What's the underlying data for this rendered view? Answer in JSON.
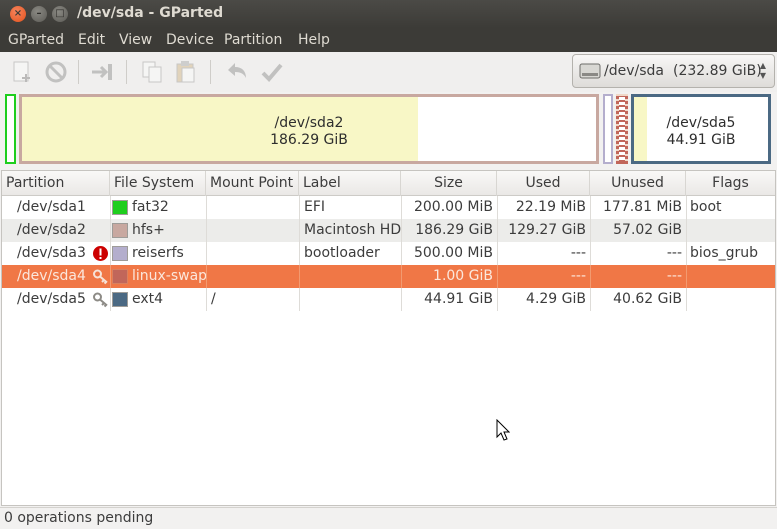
{
  "window": {
    "title": "/dev/sda - GParted"
  },
  "menu": [
    "GParted",
    "Edit",
    "View",
    "Device",
    "Partition",
    "Help"
  ],
  "toolbar": {
    "buttons": [
      "new-icon",
      "delete-icon",
      "resize-move-icon",
      "copy-icon",
      "paste-icon",
      "undo-icon",
      "apply-icon"
    ]
  },
  "device": {
    "name": "/dev/sda",
    "size": "(232.89 GiB)"
  },
  "partition_map": {
    "sda2": {
      "name": "/dev/sda2",
      "size": "186.29 GiB",
      "used_fraction": 0.69
    },
    "sda5": {
      "name": "/dev/sda5",
      "size": "44.91 GiB",
      "used_fraction": 0.1
    }
  },
  "columns": [
    "Partition",
    "File System",
    "Mount Point",
    "Label",
    "Size",
    "Used",
    "Unused",
    "Flags"
  ],
  "rows": [
    {
      "partition": "/dev/sda1",
      "icon": "",
      "fs": "fat32",
      "color": "#1ece1e",
      "mount": "",
      "label": "EFI",
      "size": "200.00 MiB",
      "used": "22.19 MiB",
      "unused": "177.81 MiB",
      "flags": "boot"
    },
    {
      "partition": "/dev/sda2",
      "icon": "",
      "fs": "hfs+",
      "color": "#c8a8a0",
      "mount": "",
      "label": "Macintosh HD",
      "size": "186.29 GiB",
      "used": "129.27 GiB",
      "unused": "57.02 GiB",
      "flags": ""
    },
    {
      "partition": "/dev/sda3",
      "icon": "warning-icon",
      "fs": "reiserfs",
      "color": "#b4aecd",
      "mount": "",
      "label": "bootloader",
      "size": "500.00 MiB",
      "used": "---",
      "unused": "---",
      "flags": "bios_grub"
    },
    {
      "partition": "/dev/sda4",
      "icon": "key-icon",
      "fs": "linux-swap",
      "color": "#c1665a",
      "mount": "",
      "label": "",
      "size": "1.00 GiB",
      "used": "---",
      "unused": "---",
      "flags": ""
    },
    {
      "partition": "/dev/sda5",
      "icon": "key-icon",
      "fs": "ext4",
      "color": "#4b6983",
      "mount": "/",
      "label": "",
      "size": "44.91 GiB",
      "used": "4.29 GiB",
      "unused": "40.62 GiB",
      "flags": ""
    }
  ],
  "selected_row": 3,
  "status": "0 operations pending"
}
